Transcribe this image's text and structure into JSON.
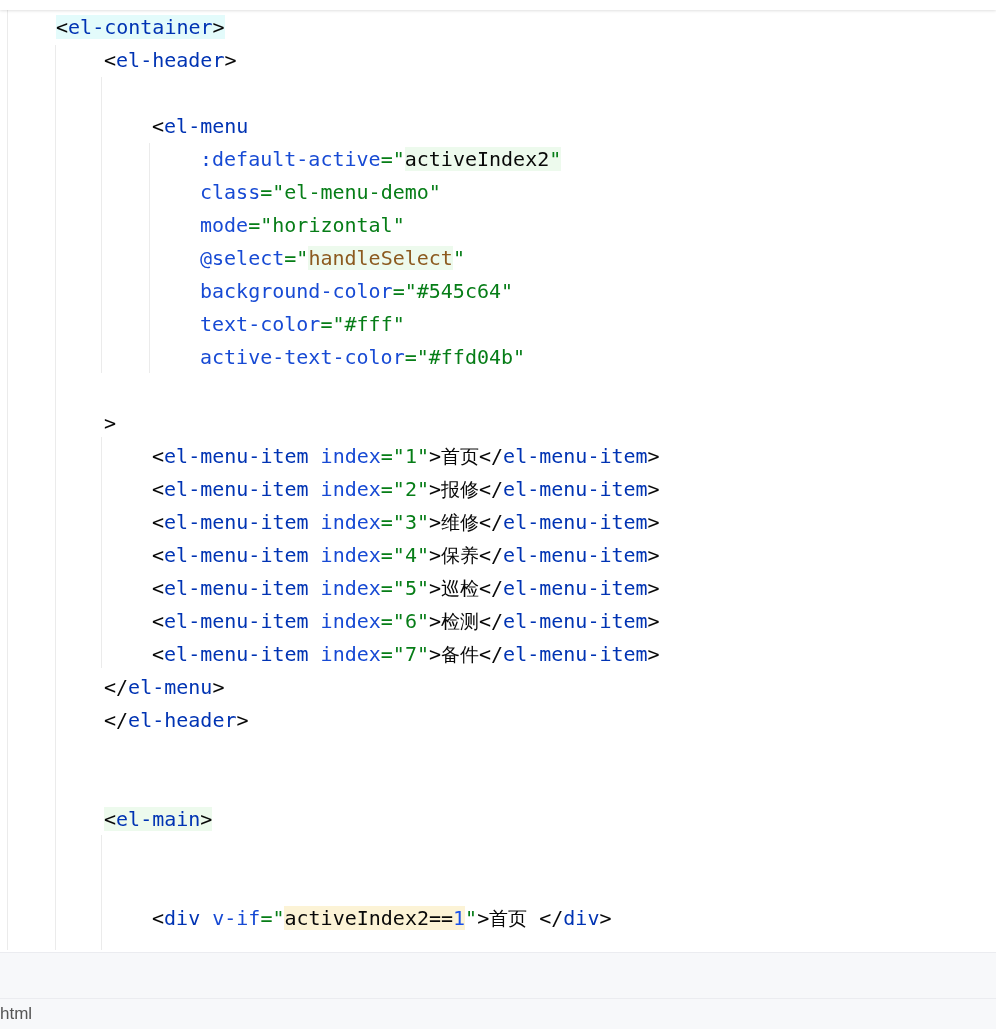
{
  "editor": {
    "lines": [
      {
        "kind": "code",
        "tokens": [
          {
            "kind": "punct",
            "text": "<",
            "color": "#e3fbfb"
          },
          {
            "kind": "tag",
            "text": "el-container",
            "color": "#e3fbfb"
          },
          {
            "kind": "punct",
            "text": ">",
            "color": "#e3fbfb"
          }
        ],
        "children": [
          {
            "kind": "code",
            "tokens": [
              {
                "kind": "punct",
                "text": "<"
              },
              {
                "kind": "tag",
                "text": "el-header"
              },
              {
                "kind": "punct",
                "text": ">"
              }
            ],
            "children": [
              {
                "kind": "blank"
              },
              {
                "kind": "code",
                "tokens": [
                  {
                    "kind": "punct",
                    "text": "<"
                  },
                  {
                    "kind": "tag",
                    "text": "el-menu"
                  }
                ],
                "children": [
                  {
                    "kind": "code",
                    "tokens": [
                      {
                        "kind": "attr",
                        "text": ":default-active"
                      },
                      {
                        "kind": "string",
                        "text": "=\""
                      },
                      {
                        "kind": "expr",
                        "text": "activeIndex2",
                        "color": "#edfaed"
                      },
                      {
                        "kind": "string",
                        "text": "\"",
                        "color": "#edfaed"
                      }
                    ]
                  },
                  {
                    "kind": "code",
                    "tokens": [
                      {
                        "kind": "attr",
                        "text": "class"
                      },
                      {
                        "kind": "string",
                        "text": "=\"el-menu-demo\""
                      }
                    ]
                  },
                  {
                    "kind": "code",
                    "tokens": [
                      {
                        "kind": "attr",
                        "text": "mode"
                      },
                      {
                        "kind": "string",
                        "text": "=\"horizontal\""
                      }
                    ]
                  },
                  {
                    "kind": "code",
                    "tokens": [
                      {
                        "kind": "attr",
                        "text": "@select"
                      },
                      {
                        "kind": "string",
                        "text": "=\""
                      },
                      {
                        "kind": "method",
                        "text": "handleSelect",
                        "color": "#edfaed"
                      },
                      {
                        "kind": "string",
                        "text": "\""
                      }
                    ]
                  },
                  {
                    "kind": "code",
                    "tokens": [
                      {
                        "kind": "attr",
                        "text": "background-color"
                      },
                      {
                        "kind": "string",
                        "text": "=\"#545c64\""
                      }
                    ]
                  },
                  {
                    "kind": "code",
                    "tokens": [
                      {
                        "kind": "attr",
                        "text": "text-color"
                      },
                      {
                        "kind": "string",
                        "text": "=\"#fff\""
                      }
                    ]
                  },
                  {
                    "kind": "code",
                    "tokens": [
                      {
                        "kind": "attr",
                        "text": "active-text-color"
                      },
                      {
                        "kind": "string",
                        "text": "=\"#ffd04b\""
                      }
                    ]
                  }
                ]
              },
              {
                "kind": "blank"
              }
            ]
          },
          {
            "kind": "code",
            "tokens": [
              {
                "kind": "punct",
                "text": ">"
              }
            ],
            "children": [
              {
                "kind": "code",
                "tokens": [
                  {
                    "kind": "punct",
                    "text": "<"
                  },
                  {
                    "kind": "tag",
                    "text": "el-menu-item"
                  },
                  {
                    "kind": "attr",
                    "text": " index"
                  },
                  {
                    "kind": "string",
                    "text": "=\"1\""
                  },
                  {
                    "kind": "punct",
                    "text": ">"
                  },
                  {
                    "kind": "cjk",
                    "text": "首页"
                  },
                  {
                    "kind": "punct",
                    "text": "</"
                  },
                  {
                    "kind": "tag",
                    "text": "el-menu-item"
                  },
                  {
                    "kind": "punct",
                    "text": ">"
                  }
                ]
              },
              {
                "kind": "code",
                "tokens": [
                  {
                    "kind": "punct",
                    "text": "<"
                  },
                  {
                    "kind": "tag",
                    "text": "el-menu-item"
                  },
                  {
                    "kind": "attr",
                    "text": " index"
                  },
                  {
                    "kind": "string",
                    "text": "=\"2\""
                  },
                  {
                    "kind": "punct",
                    "text": ">"
                  },
                  {
                    "kind": "cjk",
                    "text": "报修"
                  },
                  {
                    "kind": "punct",
                    "text": "</"
                  },
                  {
                    "kind": "tag",
                    "text": "el-menu-item"
                  },
                  {
                    "kind": "punct",
                    "text": ">"
                  }
                ]
              },
              {
                "kind": "code",
                "tokens": [
                  {
                    "kind": "punct",
                    "text": "<"
                  },
                  {
                    "kind": "tag",
                    "text": "el-menu-item"
                  },
                  {
                    "kind": "attr",
                    "text": " index"
                  },
                  {
                    "kind": "string",
                    "text": "=\"3\""
                  },
                  {
                    "kind": "punct",
                    "text": ">"
                  },
                  {
                    "kind": "cjk",
                    "text": "维修"
                  },
                  {
                    "kind": "punct",
                    "text": "</"
                  },
                  {
                    "kind": "tag",
                    "text": "el-menu-item"
                  },
                  {
                    "kind": "punct",
                    "text": ">"
                  }
                ]
              },
              {
                "kind": "code",
                "tokens": [
                  {
                    "kind": "punct",
                    "text": "<"
                  },
                  {
                    "kind": "tag",
                    "text": "el-menu-item"
                  },
                  {
                    "kind": "attr",
                    "text": " index"
                  },
                  {
                    "kind": "string",
                    "text": "=\"4\""
                  },
                  {
                    "kind": "punct",
                    "text": ">"
                  },
                  {
                    "kind": "cjk",
                    "text": "保养"
                  },
                  {
                    "kind": "punct",
                    "text": "</"
                  },
                  {
                    "kind": "tag",
                    "text": "el-menu-item"
                  },
                  {
                    "kind": "punct",
                    "text": ">"
                  }
                ]
              },
              {
                "kind": "code",
                "tokens": [
                  {
                    "kind": "punct",
                    "text": "<"
                  },
                  {
                    "kind": "tag",
                    "text": "el-menu-item"
                  },
                  {
                    "kind": "attr",
                    "text": " index"
                  },
                  {
                    "kind": "string",
                    "text": "=\"5\""
                  },
                  {
                    "kind": "punct",
                    "text": ">"
                  },
                  {
                    "kind": "cjk",
                    "text": "巡检"
                  },
                  {
                    "kind": "punct",
                    "text": "</"
                  },
                  {
                    "kind": "tag",
                    "text": "el-menu-item"
                  },
                  {
                    "kind": "punct",
                    "text": ">"
                  }
                ]
              },
              {
                "kind": "code",
                "tokens": [
                  {
                    "kind": "punct",
                    "text": "<"
                  },
                  {
                    "kind": "tag",
                    "text": "el-menu-item"
                  },
                  {
                    "kind": "attr",
                    "text": " index"
                  },
                  {
                    "kind": "string",
                    "text": "=\"6\""
                  },
                  {
                    "kind": "punct",
                    "text": ">"
                  },
                  {
                    "kind": "cjk",
                    "text": "检测"
                  },
                  {
                    "kind": "punct",
                    "text": "</"
                  },
                  {
                    "kind": "tag",
                    "text": "el-menu-item"
                  },
                  {
                    "kind": "punct",
                    "text": ">"
                  }
                ]
              },
              {
                "kind": "code",
                "tokens": [
                  {
                    "kind": "punct",
                    "text": "<"
                  },
                  {
                    "kind": "tag",
                    "text": "el-menu-item"
                  },
                  {
                    "kind": "attr",
                    "text": " index"
                  },
                  {
                    "kind": "string",
                    "text": "=\"7\""
                  },
                  {
                    "kind": "punct",
                    "text": ">"
                  },
                  {
                    "kind": "cjk",
                    "text": "备件"
                  },
                  {
                    "kind": "punct",
                    "text": "</"
                  },
                  {
                    "kind": "tag",
                    "text": "el-menu-item"
                  },
                  {
                    "kind": "punct",
                    "text": ">"
                  }
                ]
              }
            ]
          },
          {
            "kind": "code",
            "tokens": [
              {
                "kind": "punct",
                "text": "</"
              },
              {
                "kind": "tag",
                "text": "el-menu"
              },
              {
                "kind": "punct",
                "text": ">"
              }
            ]
          },
          {
            "kind": "code",
            "tokens": [
              {
                "kind": "punct",
                "text": "</"
              },
              {
                "kind": "tag",
                "text": "el-header"
              },
              {
                "kind": "punct",
                "text": ">"
              }
            ]
          },
          {
            "kind": "blank"
          },
          {
            "kind": "blank"
          },
          {
            "kind": "code",
            "tokens": [
              {
                "kind": "punct",
                "text": "<",
                "color": "#edfaed"
              },
              {
                "kind": "tag",
                "text": "el-main",
                "color": "#edfaed"
              },
              {
                "kind": "punct",
                "text": ">",
                "color": "#edfaed"
              }
            ],
            "children": [
              {
                "kind": "blank"
              },
              {
                "kind": "blank"
              },
              {
                "kind": "code",
                "tokens": [
                  {
                    "kind": "punct",
                    "text": "<"
                  },
                  {
                    "kind": "tag",
                    "text": "div"
                  },
                  {
                    "kind": "attr",
                    "text": " v-if"
                  },
                  {
                    "kind": "string",
                    "text": "=\""
                  },
                  {
                    "kind": "expr",
                    "text": "activeIndex2==",
                    "color": "#fcf3d6"
                  },
                  {
                    "kind": "number",
                    "text": "1",
                    "color": "#fcf3d6"
                  },
                  {
                    "kind": "string",
                    "text": "\""
                  },
                  {
                    "kind": "punct",
                    "text": ">"
                  },
                  {
                    "kind": "cjk",
                    "text": "首页"
                  },
                  {
                    "kind": "punct",
                    "text": " </"
                  },
                  {
                    "kind": "tag",
                    "text": "div"
                  },
                  {
                    "kind": "punct",
                    "text": ">"
                  }
                ]
              }
            ]
          }
        ]
      }
    ]
  },
  "status_bar": {
    "file_type": "html"
  }
}
